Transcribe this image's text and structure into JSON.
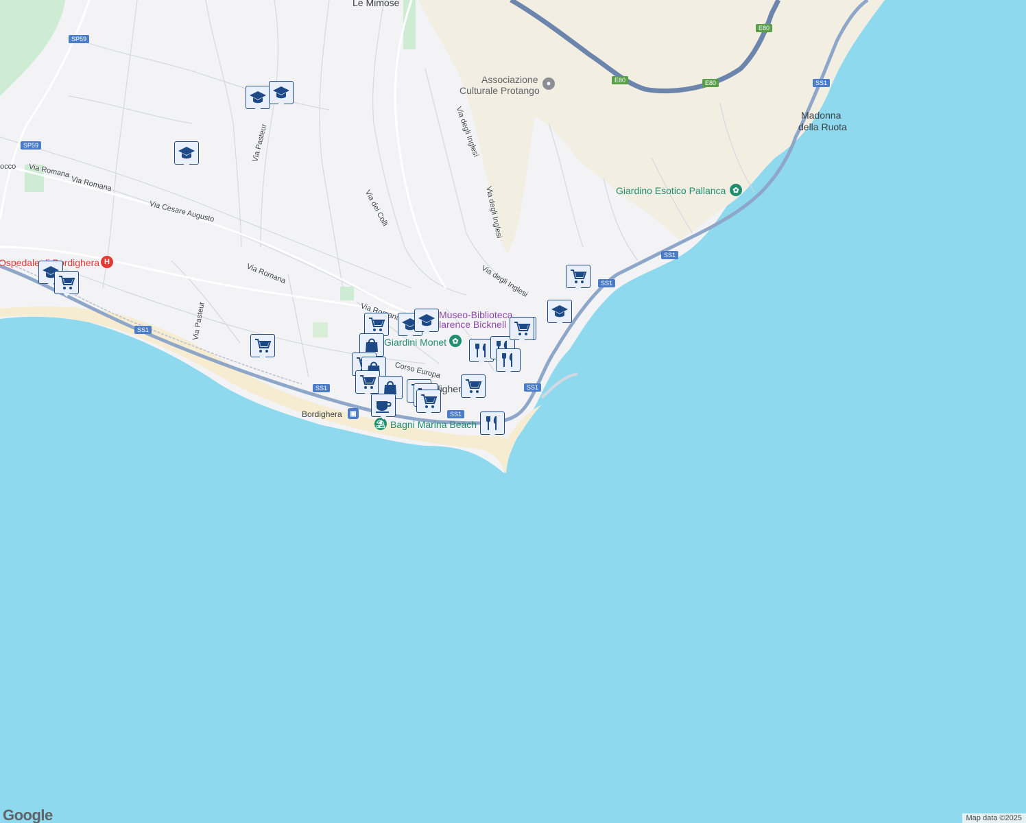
{
  "map": {
    "place_labels": [
      {
        "id": "le-mimose",
        "text": "Le Mimose"
      },
      {
        "id": "madonna-1",
        "text": "Madonna"
      },
      {
        "id": "madonna-2",
        "text": "della Ruota"
      },
      {
        "id": "bordighera-town",
        "text": "Bordighera"
      }
    ],
    "poi_labels": [
      {
        "id": "assoc-1",
        "text": "Associazione"
      },
      {
        "id": "assoc-2",
        "text": "Culturale Protango"
      },
      {
        "id": "giardino",
        "text": "Giardino Esotico Pallanca"
      },
      {
        "id": "ospedale",
        "text": "Ospedale di Bordighera"
      },
      {
        "id": "museo-1",
        "text": "Museo-Biblioteca"
      },
      {
        "id": "museo-2",
        "text": "Clarence Bicknell"
      },
      {
        "id": "monet",
        "text": "Giardini Monet"
      },
      {
        "id": "bagni",
        "text": "Bagni Marina Beach"
      },
      {
        "id": "station",
        "text": "Bordighera"
      }
    ],
    "streets": [
      {
        "id": "via-romana-1",
        "text": "Via Romana"
      },
      {
        "id": "via-romana-2",
        "text": "Via Romana"
      },
      {
        "id": "via-romana-3",
        "text": "Via Romana"
      },
      {
        "id": "via-romana-4",
        "text": "Via Romana"
      },
      {
        "id": "via-cesare",
        "text": "Via Cesare Augusto"
      },
      {
        "id": "via-pasteur-1",
        "text": "Via Pasteur"
      },
      {
        "id": "via-pasteur-2",
        "text": "Via Pasteur"
      },
      {
        "id": "via-colli",
        "text": "Via dei Colli"
      },
      {
        "id": "via-inglesi-1",
        "text": "Via degli Inglesi"
      },
      {
        "id": "via-inglesi-2",
        "text": "Via degli Inglesi"
      },
      {
        "id": "via-inglesi-3",
        "text": "Via degli Inglesi"
      },
      {
        "id": "corso-europa",
        "text": "Corso Europa"
      },
      {
        "id": "via-occo",
        "text": "occo"
      }
    ],
    "road_shields": [
      {
        "id": "sp59-a",
        "text": "SP59",
        "color": "#4a7cc9"
      },
      {
        "id": "sp59-b",
        "text": "SP59",
        "color": "#4a7cc9"
      },
      {
        "id": "ss1-a",
        "text": "SS1",
        "color": "#4a7cc9"
      },
      {
        "id": "ss1-b",
        "text": "SS1",
        "color": "#4a7cc9"
      },
      {
        "id": "ss1-c",
        "text": "SS1",
        "color": "#4a7cc9"
      },
      {
        "id": "ss1-d",
        "text": "SS1",
        "color": "#4a7cc9"
      },
      {
        "id": "ss1-e",
        "text": "SS1",
        "color": "#4a7cc9"
      },
      {
        "id": "ss1-f",
        "text": "SS1",
        "color": "#4a7cc9"
      },
      {
        "id": "ss1-g",
        "text": "SS1",
        "color": "#4a7cc9"
      },
      {
        "id": "e80-a",
        "text": "E80",
        "color": "#5a9e4a"
      },
      {
        "id": "e80-b",
        "text": "E80",
        "color": "#5a9e4a"
      },
      {
        "id": "e80-c",
        "text": "E80",
        "color": "#5a9e4a"
      }
    ],
    "markers": [
      {
        "type": "school"
      },
      {
        "type": "school"
      },
      {
        "type": "school"
      },
      {
        "type": "school"
      },
      {
        "type": "cart"
      },
      {
        "type": "cart"
      },
      {
        "type": "cart"
      },
      {
        "type": "school"
      },
      {
        "type": "school"
      },
      {
        "type": "cart"
      },
      {
        "type": "bag"
      },
      {
        "type": "cart"
      },
      {
        "type": "bag"
      },
      {
        "type": "cart"
      },
      {
        "type": "bag"
      },
      {
        "type": "cart"
      },
      {
        "type": "cart"
      },
      {
        "type": "cart"
      },
      {
        "type": "coffee"
      },
      {
        "type": "cart"
      },
      {
        "type": "restaurant"
      },
      {
        "type": "restaurant"
      },
      {
        "type": "restaurant"
      },
      {
        "type": "restaurant"
      },
      {
        "type": "restaurant"
      },
      {
        "type": "cart"
      },
      {
        "type": "school"
      }
    ],
    "colors": {
      "sea": "#8fd9ee",
      "land": "#f3f3f5",
      "hills": "#f2efe2",
      "park": "#cdecd3",
      "beach": "#f6ecd2",
      "highway": "#6c85ad",
      "main_road": "#8ea7c9",
      "marker_border": "#1d4a86",
      "marker_fill": "#eaf0fb",
      "hospital": "#e53935",
      "museum": "#8e44ad",
      "garden": "#1e8e6e"
    }
  },
  "footer": {
    "logo": "Google",
    "attribution": "Map data ©2025"
  }
}
